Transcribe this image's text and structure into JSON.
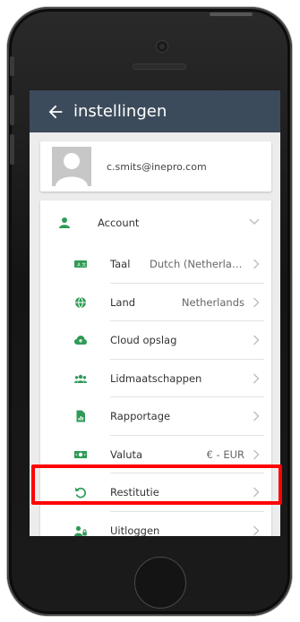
{
  "header": {
    "title": "instellingen"
  },
  "profile": {
    "email": "c.smits@inepro.com"
  },
  "account": {
    "label": "Account"
  },
  "menu": [
    {
      "icon": "language-icon",
      "label": "Taal",
      "value": "Dutch (Netherlands)"
    },
    {
      "icon": "globe-icon",
      "label": "Land",
      "value": "Netherlands"
    },
    {
      "icon": "cloud-icon",
      "label": "Cloud opslag",
      "value": ""
    },
    {
      "icon": "group-icon",
      "label": "Lidmaatschappen",
      "value": ""
    },
    {
      "icon": "report-icon",
      "label": "Rapportage",
      "value": ""
    },
    {
      "icon": "money-icon",
      "label": "Valuta",
      "value": "€ - EUR"
    },
    {
      "icon": "refund-icon",
      "label": "Restitutie",
      "value": ""
    },
    {
      "icon": "logout-user-icon",
      "label": "Uitloggen",
      "value": ""
    }
  ],
  "colors": {
    "appbar": "#3c4b5b",
    "icon_green": "#2e9b57",
    "highlight": "#ff0000"
  }
}
